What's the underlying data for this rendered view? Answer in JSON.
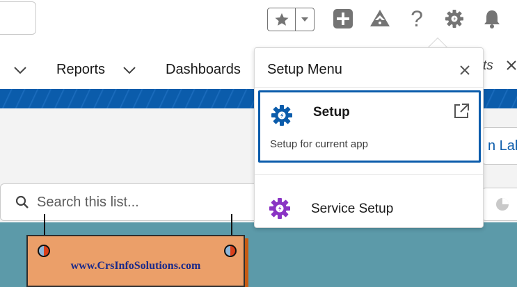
{
  "header": {
    "favorites": {
      "star_icon": "star-icon",
      "dropdown_icon": "caret-down-icon"
    },
    "icons": [
      "add-icon",
      "trailhead-icon",
      "help-icon",
      "setup-gear-icon",
      "notifications-bell-icon"
    ],
    "help_glyph": "?"
  },
  "nav": {
    "items": [
      {
        "label": "Reports"
      },
      {
        "label": "Dashboards"
      }
    ],
    "overflow_tab_label": "ts"
  },
  "list": {
    "search_placeholder": "Search this list...",
    "right_button_label": "n Lab"
  },
  "setup_menu": {
    "title": "Setup Menu",
    "items": [
      {
        "label": "Setup",
        "description": "Setup for current app"
      },
      {
        "label": "Service Setup"
      }
    ]
  },
  "watermark": {
    "text": "www.CrsInfoSolutions.com"
  },
  "colors": {
    "brand": "#0b5cab",
    "teal_band": "#5c9aa9",
    "service_icon": "#8a33c4",
    "watermark_board": "#eb9f69"
  }
}
